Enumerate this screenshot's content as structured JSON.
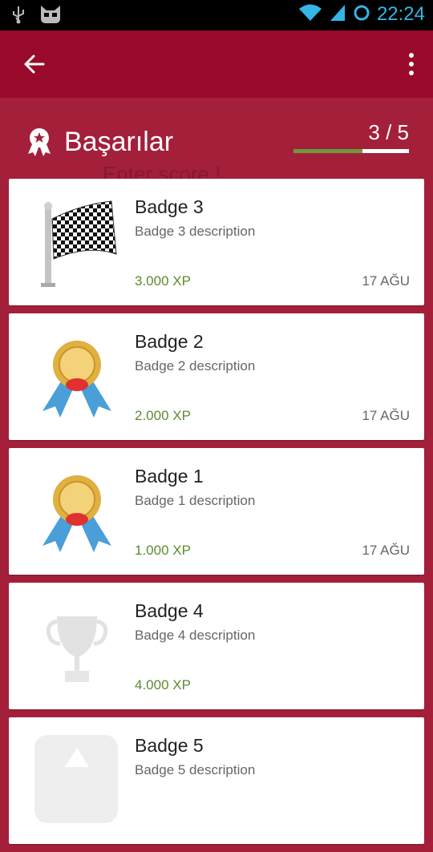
{
  "status_bar": {
    "time": "22:24"
  },
  "app_bar": {
    "back_icon": "arrow-left-icon",
    "menu_icon": "more-vert-icon"
  },
  "header": {
    "title": "Başarılar",
    "ghost_text": "Enter score !",
    "progress_text": "3 / 5",
    "progress_fraction": 0.6
  },
  "badges": [
    {
      "title": "Badge 3",
      "description": "Badge 3 description",
      "xp": "3.000 XP",
      "date": "17 AĞU",
      "icon": "checkered-flag-icon"
    },
    {
      "title": "Badge 2",
      "description": "Badge 2 description",
      "xp": "2.000 XP",
      "date": "17 AĞU",
      "icon": "gold-medal-icon"
    },
    {
      "title": "Badge 1",
      "description": "Badge 1 description",
      "xp": "1.000 XP",
      "date": "17 AĞU",
      "icon": "gold-medal-icon"
    },
    {
      "title": "Badge 4",
      "description": "Badge 4 description",
      "xp": "4.000 XP",
      "date": "",
      "icon": "trophy-icon"
    },
    {
      "title": "Badge 5",
      "description": "Badge 5 description",
      "xp": "",
      "date": "",
      "icon": "shield-badge-icon"
    }
  ],
  "colors": {
    "accent": "#98092b",
    "background": "#a41f3a",
    "xp_green": "#5d8b2e",
    "status_blue": "#33b5e5"
  }
}
